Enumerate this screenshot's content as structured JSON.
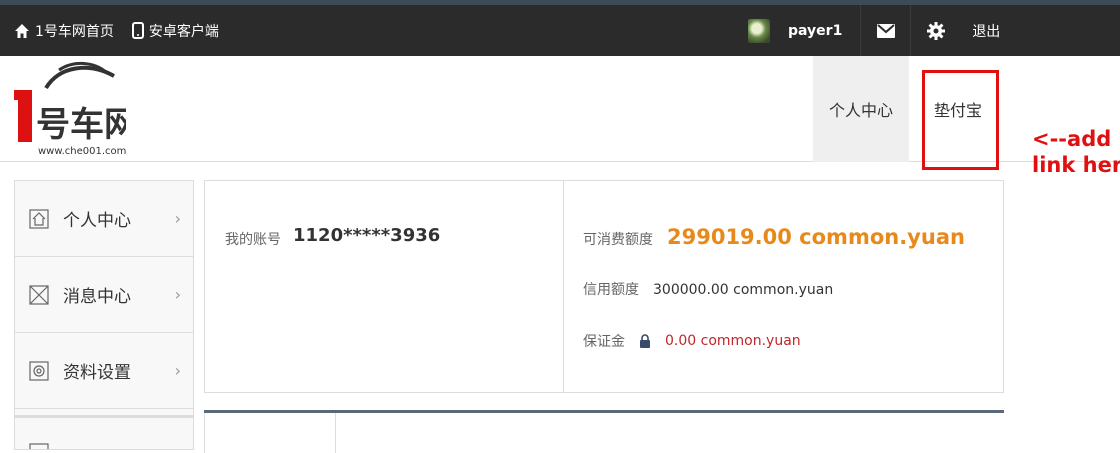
{
  "topbar": {
    "home_label": "1号车网首页",
    "android_label": "安卓客户端",
    "username": "payer1",
    "logout_label": "退出"
  },
  "header": {
    "logo_url_text": "www.che001.com",
    "nav": [
      {
        "label": "个人中心",
        "active": true
      },
      {
        "label": "垫付宝",
        "active": false
      }
    ]
  },
  "annotation": {
    "line1": "<--add",
    "line2": "link here",
    "color": "#e01010"
  },
  "sidebar": {
    "items": [
      {
        "label": "个人中心",
        "icon": "home-icon"
      },
      {
        "label": "消息中心",
        "icon": "message-icon"
      },
      {
        "label": "资料设置",
        "icon": "settings-icon"
      }
    ]
  },
  "account": {
    "account_label": "我的账号",
    "account_value": "1120*****3936",
    "spendable_label": "可消费额度",
    "spendable_value": "299019.00 common.yuan",
    "credit_label": "信用额度",
    "credit_value": "300000.00 common.yuan",
    "deposit_label": "保证金",
    "deposit_value": "0.00 common.yuan",
    "accent_color": "#e8891c"
  }
}
